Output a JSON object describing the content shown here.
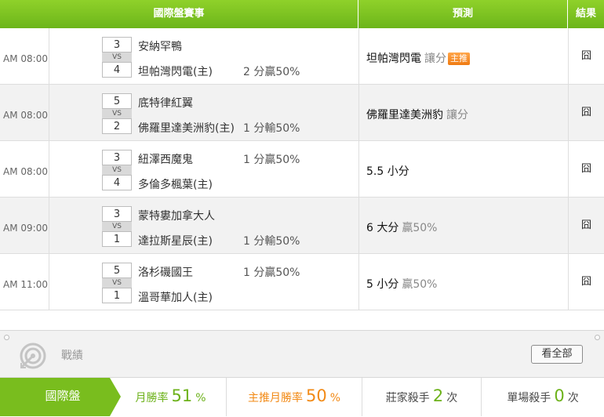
{
  "header": {
    "event_label": "國際盤賽事",
    "prediction_label": "預測",
    "result_label": "結果"
  },
  "rows": [
    {
      "time": "AM 08:00",
      "score_top": "3",
      "vs": "VS",
      "score_bot": "4",
      "team1": "安納罕鴨",
      "team2": "坦帕灣閃電(主)",
      "line1": "",
      "line2": "2 分贏50%",
      "prediction": "坦帕灣閃電",
      "prediction_sub": "讓分",
      "badge": "主推",
      "result": "囧"
    },
    {
      "time": "AM 08:00",
      "score_top": "5",
      "vs": "VS",
      "score_bot": "2",
      "team1": "底特律紅翼",
      "team2": "佛羅里達美洲豹(主)",
      "line1": "",
      "line2": "1 分輸50%",
      "prediction": "佛羅里達美洲豹",
      "prediction_sub": "讓分",
      "badge": "",
      "result": "囧"
    },
    {
      "time": "AM 08:00",
      "score_top": "3",
      "vs": "VS",
      "score_bot": "4",
      "team1": "紐澤西魔鬼",
      "team2": "多倫多楓葉(主)",
      "line1": "1 分贏50%",
      "line2": "",
      "prediction": "5.5 小分",
      "prediction_sub": "",
      "badge": "",
      "result": "囧"
    },
    {
      "time": "AM 09:00",
      "score_top": "3",
      "vs": "VS",
      "score_bot": "1",
      "team1": "蒙特婁加拿大人",
      "team2": "達拉斯星辰(主)",
      "line1": "",
      "line2": "1 分輸50%",
      "prediction": "6 大分",
      "prediction_sub": "贏50%",
      "badge": "",
      "result": "囧"
    },
    {
      "time": "AM 11:00",
      "score_top": "5",
      "vs": "VS",
      "score_bot": "1",
      "team1": "洛杉磯國王",
      "team2": "溫哥華加人(主)",
      "line1": "1 分贏50%",
      "line2": "",
      "prediction": "5 小分",
      "prediction_sub": "贏50%",
      "badge": "",
      "result": "囧"
    }
  ],
  "panel": {
    "title": "戰績",
    "view_all": "看全部"
  },
  "stats": {
    "label": "國際盤",
    "monthly_label": "月勝率",
    "monthly_value": "51",
    "monthly_unit": "%",
    "main_label": "主推月勝率",
    "main_value": "50",
    "main_unit": "%",
    "banker_label": "莊家殺手",
    "banker_value": "2",
    "banker_unit": "次",
    "single_label": "單場殺手",
    "single_value": "0",
    "single_unit": "次"
  },
  "colors": {
    "header_green": "#79bd1e",
    "accent_orange": "#f28a16",
    "badge_orange": "#f07a10"
  }
}
